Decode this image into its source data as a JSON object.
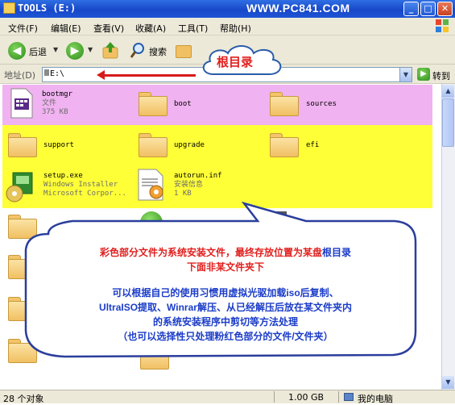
{
  "window": {
    "title": "TOOLS (E:)",
    "site_label": "WWW.PC841.COM",
    "min_glyph": "_",
    "max_glyph": "□",
    "close_glyph": "✕"
  },
  "menu": {
    "items": [
      "文件(F)",
      "编辑(E)",
      "查看(V)",
      "收藏(A)",
      "工具(T)",
      "帮助(H)"
    ]
  },
  "toolbar": {
    "back_label": "后退",
    "search_label": "搜索"
  },
  "address": {
    "label": "地址(D)",
    "value": "E:\\",
    "go_label": "转到"
  },
  "files": [
    {
      "name": "bootmgr",
      "type": "文件",
      "size": "375 KB"
    },
    {
      "name": "boot"
    },
    {
      "name": "sources"
    },
    {
      "name": "support"
    },
    {
      "name": "upgrade"
    },
    {
      "name": "efi"
    },
    {
      "name": "setup.exe",
      "type": "Windows Installer",
      "company": "Microsoft Corpor..."
    },
    {
      "name": "autorun.inf",
      "type": "安装信息",
      "size": "1 KB"
    }
  ],
  "callouts": {
    "root_label": "根目录",
    "line1_red_part1": "彩色部分文件为系统安装文件，最终存放位置为某盘",
    "line1_red_part2": "根目录",
    "line2": "下面非某文件夹下",
    "line3": "可以根据自己的使用习惯用虚拟光驱加载iso后复制、",
    "line4": "UltraISO提取、Winrar解压、从已经解压后放在某文件夹内",
    "line5": "的系统安装程序中剪切等方法处理",
    "line6": "（也可以选择性只处理粉红色部分的文件/文件夹）"
  },
  "status": {
    "count": "28 个对象",
    "size": "1.00 GB",
    "location": "我的电脑"
  },
  "colors": {
    "pink_highlight": "#f0b2f0",
    "yellow_highlight": "#ffff38",
    "callout_red": "#e0201e",
    "callout_blue": "#1b3cc8"
  }
}
